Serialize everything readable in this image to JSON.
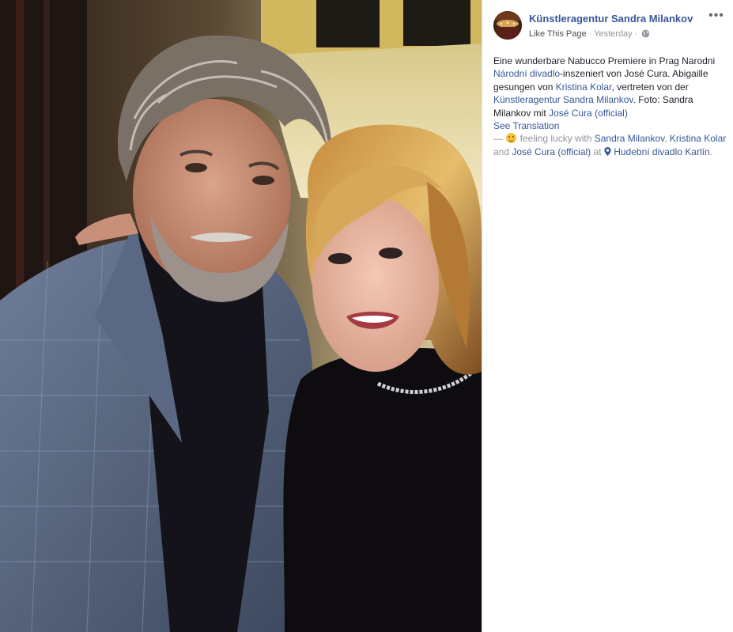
{
  "photo": {
    "description_icon": "photo-selfie"
  },
  "header": {
    "page_name": "Künstleragentur Sandra Milankov",
    "like_label": "Like This Page",
    "separator": " · ",
    "timestamp": "Yesterday",
    "separator2": " · ",
    "privacy_icon": "globe-icon",
    "more_icon": "more-dots-icon"
  },
  "post": {
    "t1": "Eine wunderbare Nabucco Premiere in Prag Narodni ",
    "link1": "Národní divadlo",
    "t2": "-inszeniert von José Cura. Abigaille gesungen von ",
    "link2": "Kristina Kolar",
    "t3": ", vertreten von der ",
    "link3": "Künstleragentur Sandra Milankov",
    "t4": ". Foto: Sandra Milankov mit ",
    "link4": "José Cura (official)",
    "see_translation": "See Translation",
    "dash": "— ",
    "feeling": " feeling lucky with ",
    "tag1": "Sandra Milankov",
    "comma": ", ",
    "tag2": "Kristina Kolar",
    "and": " and ",
    "tag3": "José Cura (official)",
    "at": " at ",
    "location": "Hudební divadlo Karlín",
    "period": "."
  },
  "colors": {
    "link": "#365899",
    "meta": "#90949c",
    "text": "#1d2129"
  }
}
